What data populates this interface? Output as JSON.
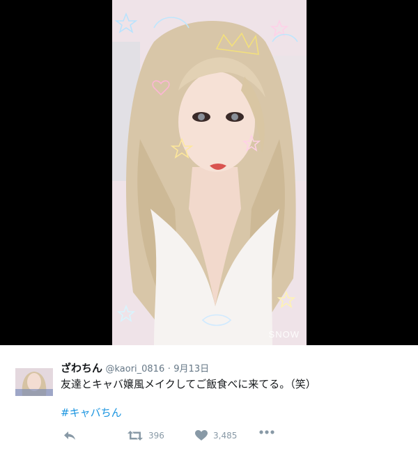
{
  "media": {
    "watermark": "SNOW"
  },
  "tweet": {
    "display_name": "ざわちん",
    "handle": "@kaori_0816",
    "separator": "·",
    "date": "9月13日",
    "text": "友達とキャバ嬢風メイクしてご飯食べに来てる。（笑）",
    "hashtag": "#キャバちん",
    "actions": {
      "retweet_count": "396",
      "like_count": "3,485"
    }
  },
  "colors": {
    "link": "#1b95e0",
    "muted": "#8899a6",
    "text": "#14171a"
  },
  "icons": [
    "reply-icon",
    "retweet-icon",
    "heart-icon",
    "more-icon"
  ]
}
